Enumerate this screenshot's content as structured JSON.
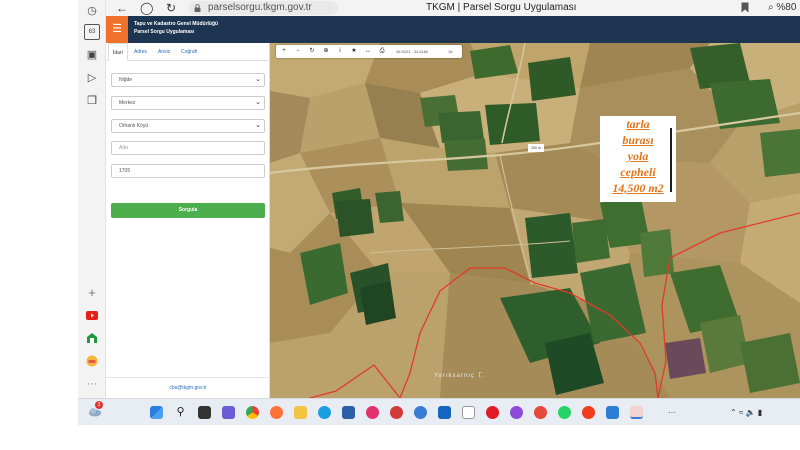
{
  "browser": {
    "url": "parselsorgu.tkgm.gov.tr",
    "tab_title": "TKGM | Parsel Sorgu Uygulaması",
    "zoom": "%80",
    "rail_badge": "63"
  },
  "app": {
    "org_name": "Tapu ve Kadastro Genel Müdürlüğü",
    "app_name": "Parsel Sorgu Uygulaması",
    "menu_icon": "hamburger-icon",
    "accent_color": "#f0722a",
    "header_color": "#1d3551"
  },
  "sidebar": {
    "tabs": [
      {
        "label": "İdari",
        "active": true
      },
      {
        "label": "Adres",
        "active": false
      },
      {
        "label": "Ansiz",
        "active": false
      },
      {
        "label": "Coğrafi",
        "active": false
      }
    ],
    "province": "Niğde",
    "district": "Merkez",
    "village": "Orhanlı Köyü",
    "block_placeholder": "Ada",
    "parcel_value": "1705",
    "query_label": "Sorgula",
    "query_color": "#4cae4c",
    "footer_email": "cbs@tkgm.gov.tr"
  },
  "map": {
    "coordinates": "36.5023 , 34.6160",
    "zoom_level": "18",
    "scale": "200 m",
    "village_label": "Yarıksarnıç T.",
    "annotation": [
      "tarla",
      "burası",
      "yola",
      "cepheli",
      "14,500 m2"
    ],
    "annotation_color": "#e0761c",
    "parcel_outline_color": "#e23a2a"
  },
  "taskbar": {
    "weather_badge": "3",
    "more_label": "···"
  }
}
